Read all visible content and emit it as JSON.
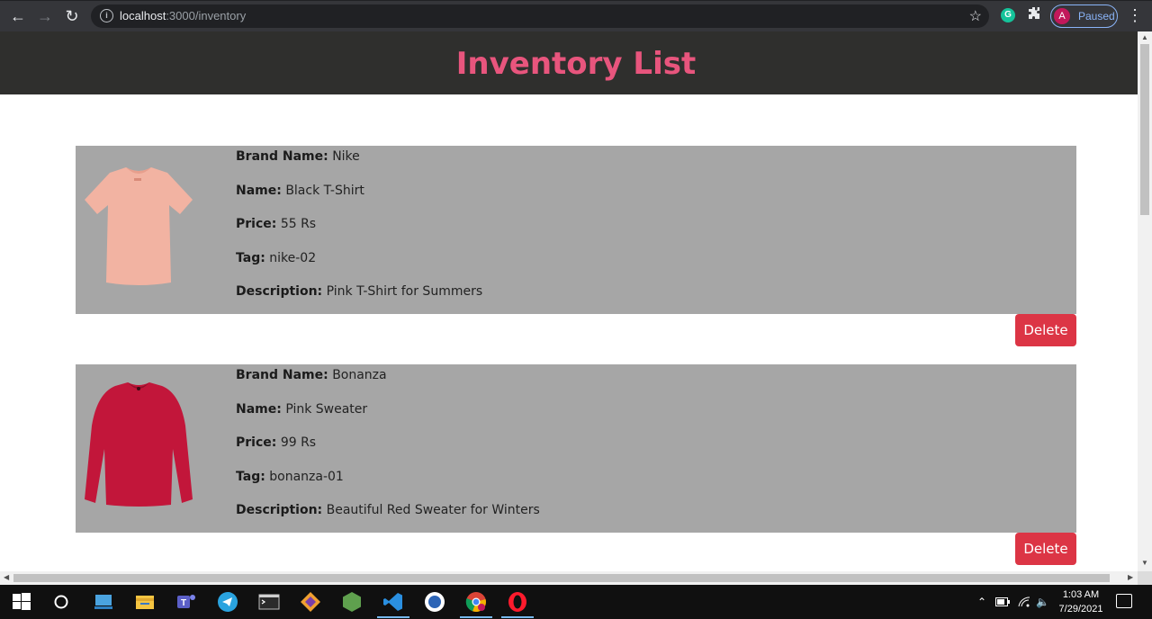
{
  "browser": {
    "url_host": "localhost",
    "url_path": ":3000/inventory",
    "profile_initial": "A",
    "profile_status": "Paused",
    "grammarly_letter": "G"
  },
  "page": {
    "title": "Inventory List",
    "accent_color": "#e8557d",
    "card_bg": "#a6a6a6",
    "delete_color": "#dc3545"
  },
  "labels": {
    "brand": "Brand Name:",
    "name": "Name:",
    "price": "Price:",
    "tag": "Tag:",
    "description": "Description:",
    "delete": "Delete"
  },
  "items": [
    {
      "brand": "Nike",
      "name": "Black T-Shirt",
      "price": "55 Rs",
      "tag": "nike-02",
      "description": "Pink T-Shirt for Summers",
      "image": "pink-tshirt"
    },
    {
      "brand": "Bonanza",
      "name": "Pink Sweater",
      "price": "99 Rs",
      "tag": "bonanza-01",
      "description": "Beautiful Red Sweater for Winters",
      "image": "red-sweater"
    }
  ],
  "taskbar": {
    "time": "1:03 AM",
    "date": "7/29/2021"
  }
}
